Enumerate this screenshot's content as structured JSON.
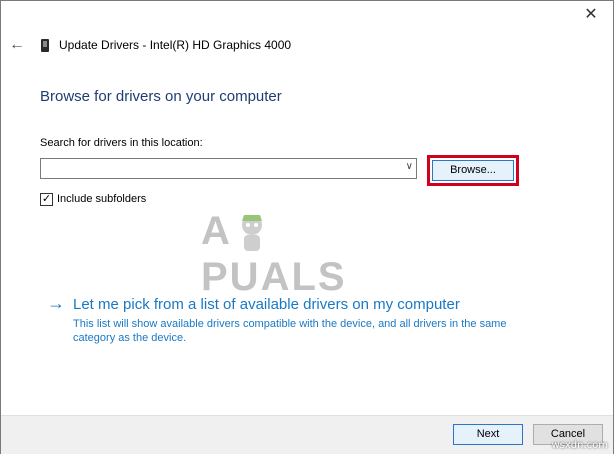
{
  "window": {
    "title": "Update Drivers - Intel(R) HD Graphics 4000",
    "close_glyph": "✕",
    "back_glyph": "←"
  },
  "main": {
    "heading": "Browse for drivers on your computer",
    "search_label": "Search for drivers in this location:",
    "path_value": "",
    "combo_arrow_glyph": "∨",
    "browse_label": "Browse...",
    "include_subfolders_label": "Include subfolders",
    "include_subfolders_checked": true,
    "pick_link": "Let me pick from a list of available drivers on my computer",
    "pick_description": "This list will show available drivers compatible with the device, and all drivers in the same category as the device.",
    "pick_arrow_glyph": "→"
  },
  "footer": {
    "next_label": "Next",
    "cancel_label": "Cancel"
  },
  "watermark": {
    "left": "A",
    "right": "PUALS",
    "site": "wsxdn.com"
  },
  "colors": {
    "accent": "#1a79c4",
    "heading": "#1f3d73",
    "highlight": "#d0021b"
  }
}
